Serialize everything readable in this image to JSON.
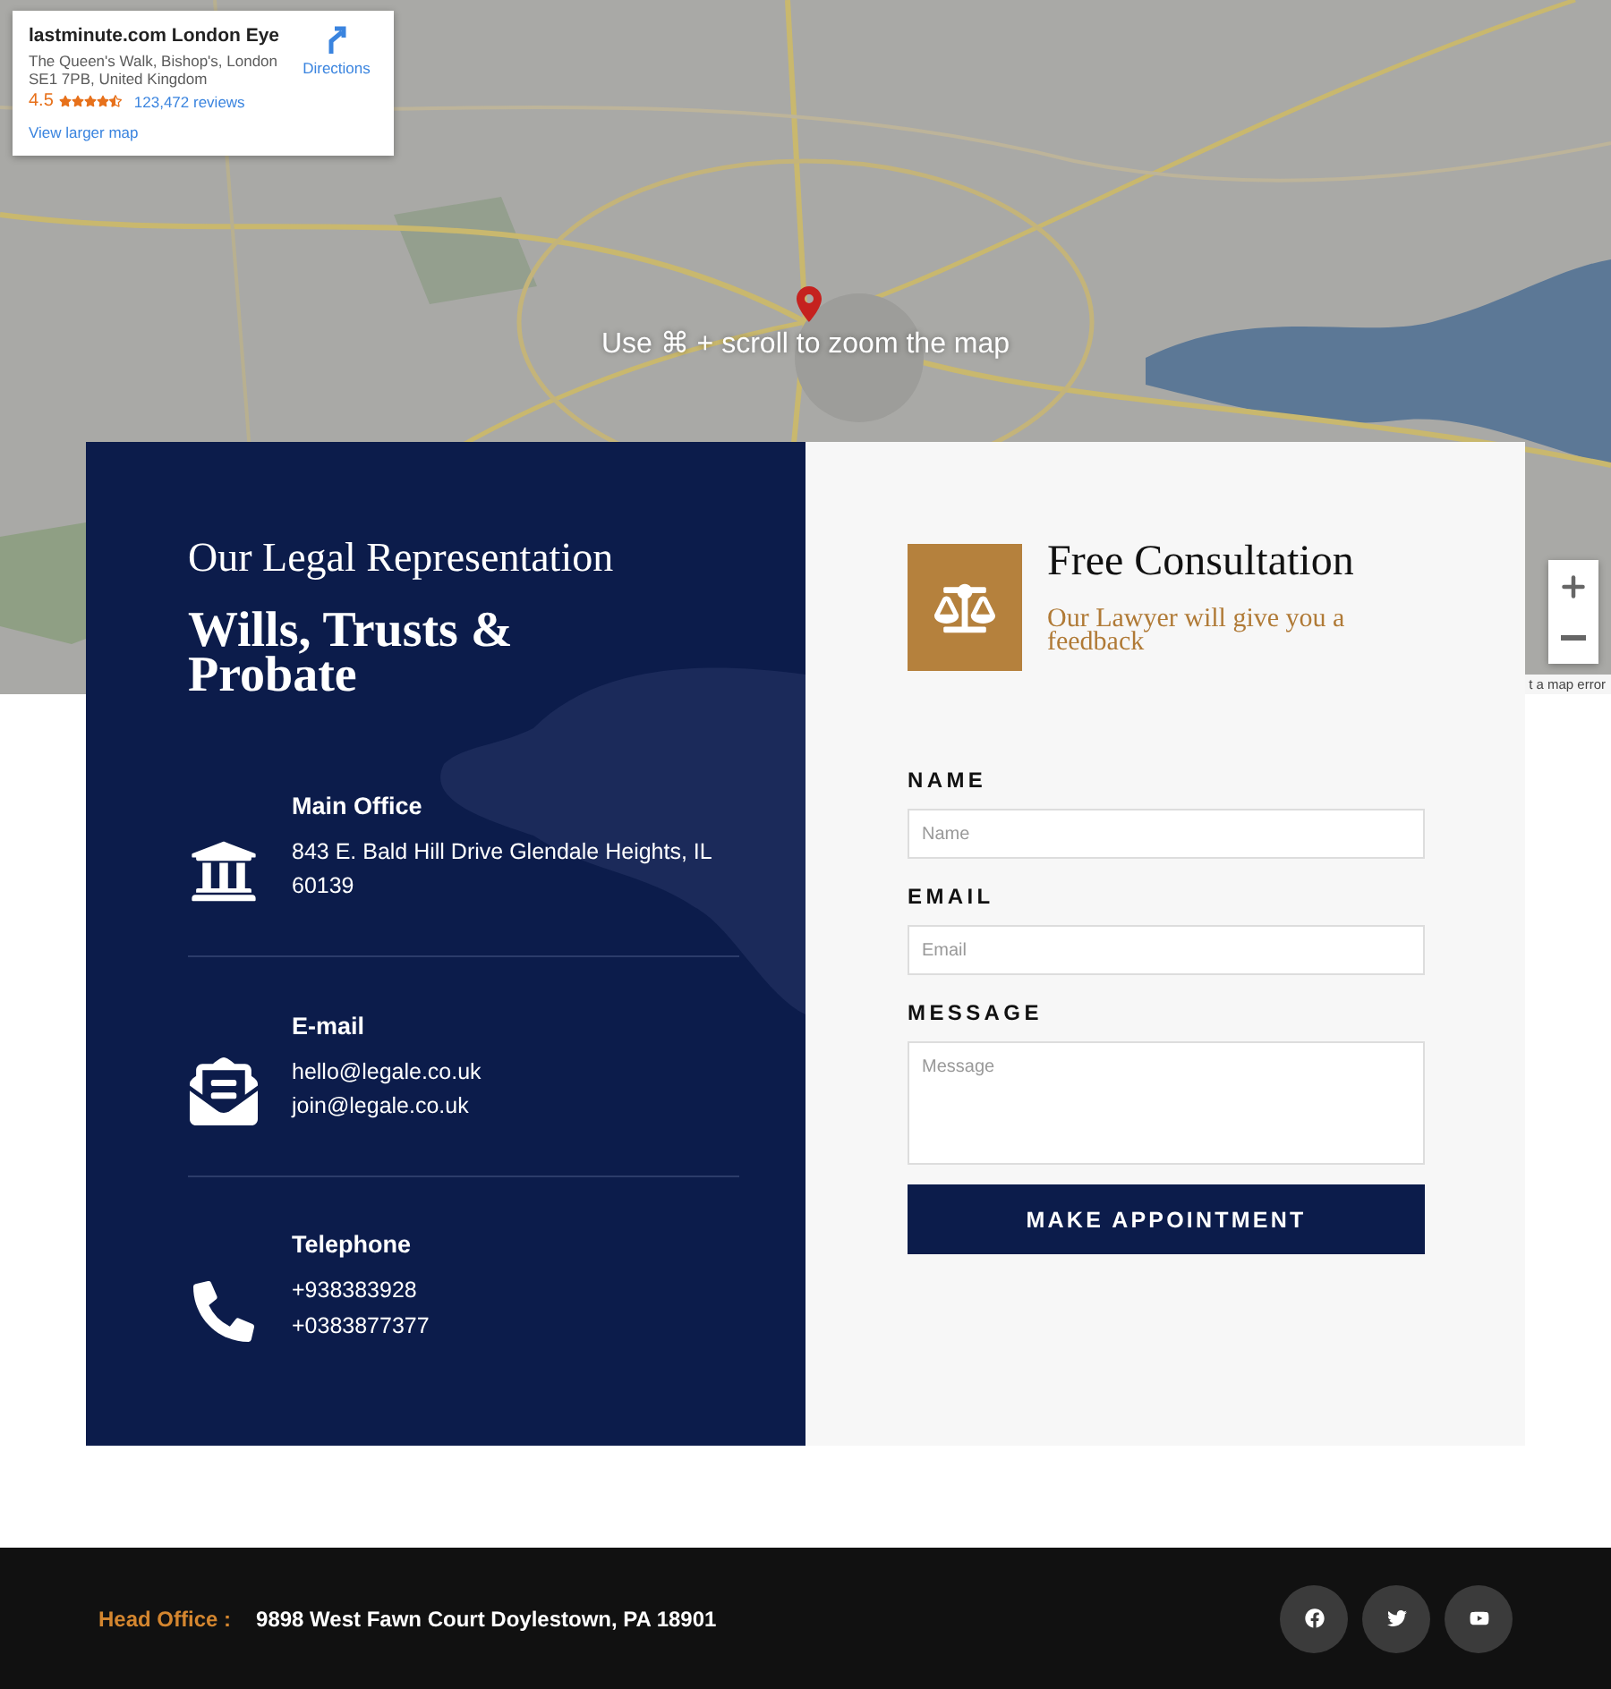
{
  "map": {
    "info_card": {
      "title": "lastminute.com London Eye",
      "address": "The Queen's Walk, Bishop's, London SE1 7PB, United Kingdom",
      "rating": "4.5",
      "stars": 4.5,
      "reviews": "123,472 reviews",
      "directions": "Directions",
      "larger_map": "View larger map"
    },
    "hint": "Use ⌘ + scroll to zoom the map",
    "report": "t a map error"
  },
  "contact": {
    "subtitle": "Our Legal Representation",
    "title": "Wills, Trusts & Probate",
    "items": [
      {
        "kind": "office",
        "heading": "Main Office",
        "lines": [
          "843 E. Bald Hill Drive Glendale Heights, IL 60139"
        ]
      },
      {
        "kind": "email",
        "heading": "E-mail",
        "lines": [
          "hello@legale.co.uk",
          "join@legale.co.uk"
        ]
      },
      {
        "kind": "phone",
        "heading": "Telephone",
        "lines": [
          "+938383928",
          "+0383877377"
        ]
      }
    ]
  },
  "consultation": {
    "title": "Free Consultation",
    "subtitle": "Our Lawyer will give you a feedback",
    "fields": [
      {
        "kind": "input",
        "label": "NAME",
        "placeholder": "Name"
      },
      {
        "kind": "input",
        "label": "EMAIL",
        "placeholder": "Email"
      },
      {
        "kind": "textarea",
        "label": "MESSAGE",
        "placeholder": "Message"
      }
    ],
    "button": "MAKE APPOINTMENT"
  },
  "footer": {
    "label": "Head Office :",
    "address": "9898 West Fawn Court Doylestown, PA 18901",
    "socials": [
      {
        "kind": "facebook"
      },
      {
        "kind": "twitter"
      },
      {
        "kind": "youtube"
      }
    ]
  }
}
